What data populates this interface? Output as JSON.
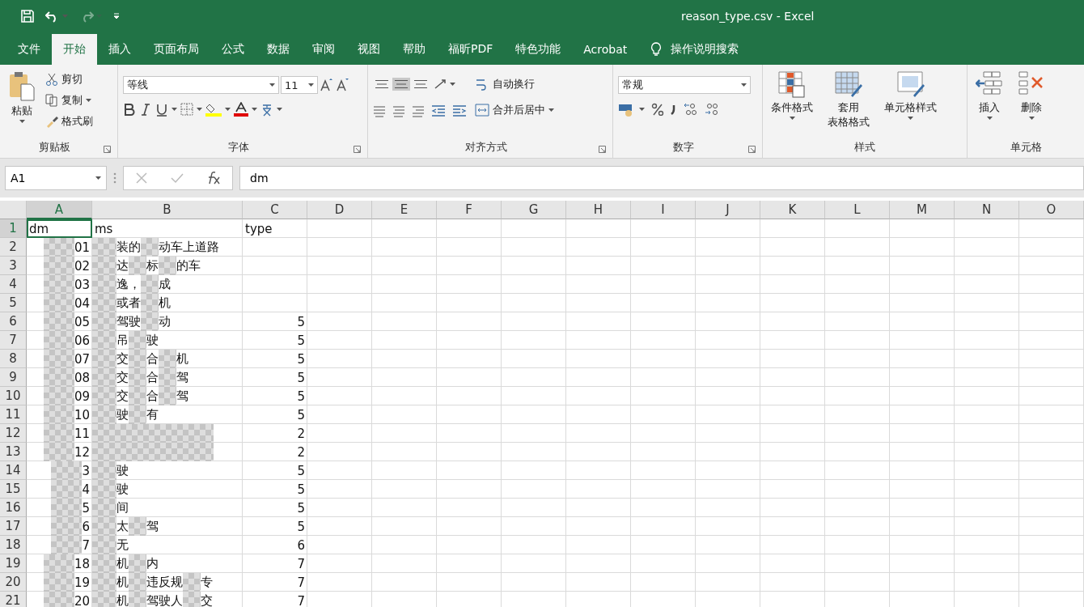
{
  "window": {
    "title": "reason_type.csv  -  Excel"
  },
  "tabs": [
    {
      "label": "文件",
      "selected": false
    },
    {
      "label": "开始",
      "selected": true
    },
    {
      "label": "插入",
      "selected": false
    },
    {
      "label": "页面布局",
      "selected": false
    },
    {
      "label": "公式",
      "selected": false
    },
    {
      "label": "数据",
      "selected": false
    },
    {
      "label": "审阅",
      "selected": false
    },
    {
      "label": "视图",
      "selected": false
    },
    {
      "label": "帮助",
      "selected": false
    },
    {
      "label": "福昕PDF",
      "selected": false
    },
    {
      "label": "特色功能",
      "selected": false
    },
    {
      "label": "Acrobat",
      "selected": false
    }
  ],
  "tell_me": {
    "placeholder": "操作说明搜索"
  },
  "ribbon": {
    "clipboard": {
      "label": "剪贴板",
      "paste": "粘贴",
      "cut": "剪切",
      "copy": "复制",
      "format_painter": "格式刷"
    },
    "font": {
      "label": "字体",
      "font_name": "等线",
      "font_size": "11"
    },
    "alignment": {
      "label": "对齐方式",
      "vertical_align": [
        {
          "selected": false
        },
        {
          "selected": true
        },
        {
          "selected": false
        }
      ],
      "wrap_text": "自动换行",
      "merge_center": "合并后居中"
    },
    "number": {
      "label": "数字",
      "format": "常规"
    },
    "styles": {
      "label": "样式",
      "conditional_format": "条件格式",
      "format_table": [
        "套用",
        "表格格式"
      ],
      "cell_styles": "单元格样式"
    },
    "cells": {
      "label": "单元格",
      "insert": "插入",
      "delete": "删除"
    }
  },
  "formula_bar": {
    "name_box": "A1",
    "formula": "dm"
  },
  "sheet": {
    "columns": [
      {
        "label": "A",
        "selected": true
      },
      {
        "label": "B",
        "selected": false
      },
      {
        "label": "C",
        "selected": false
      },
      {
        "label": "D",
        "selected": false
      },
      {
        "label": "E",
        "selected": false
      },
      {
        "label": "F",
        "selected": false
      },
      {
        "label": "G",
        "selected": false
      },
      {
        "label": "H",
        "selected": false
      },
      {
        "label": "I",
        "selected": false
      },
      {
        "label": "J",
        "selected": false
      },
      {
        "label": "K",
        "selected": false
      },
      {
        "label": "L",
        "selected": false
      },
      {
        "label": "M",
        "selected": false
      },
      {
        "label": "N",
        "selected": false
      },
      {
        "label": "O",
        "selected": false
      }
    ],
    "header_row": {
      "num": "1",
      "selected": true,
      "cells": [
        "dm",
        "ms",
        "type"
      ]
    },
    "rows": [
      {
        "num": "2",
        "dm": "01",
        "ms": [
          "装的",
          "动车上道路"
        ]
      },
      {
        "num": "3",
        "dm": "02",
        "ms": [
          "达",
          "标",
          "的车"
        ]
      },
      {
        "num": "4",
        "dm": "03",
        "ms": [
          "逸，",
          "成"
        ]
      },
      {
        "num": "5",
        "dm": "04",
        "ms": [
          "或者",
          "机"
        ]
      },
      {
        "num": "6",
        "dm": "05",
        "ms": [
          "驾驶",
          "动"
        ],
        "type": "5"
      },
      {
        "num": "7",
        "dm": "06",
        "ms": [
          "吊",
          "驶"
        ],
        "type": "5"
      },
      {
        "num": "8",
        "dm": "07",
        "ms": [
          "交",
          "合",
          "机"
        ],
        "type": "5"
      },
      {
        "num": "9",
        "dm": "08",
        "ms": [
          "交",
          "合",
          "驾"
        ],
        "type": "5"
      },
      {
        "num": "10",
        "dm": "09",
        "ms": [
          "交",
          "合",
          "驾"
        ],
        "type": "5"
      },
      {
        "num": "11",
        "dm": "10",
        "ms": [
          "驶",
          "有"
        ],
        "type": "5"
      },
      {
        "num": "12",
        "dm": "11",
        "ms": [],
        "type": "2"
      },
      {
        "num": "13",
        "dm": "12",
        "ms": [],
        "type": "2"
      },
      {
        "num": "14",
        "dm": "3",
        "ms": [
          "驶"
        ],
        "type": "5"
      },
      {
        "num": "15",
        "dm": "4",
        "ms": [
          "驶"
        ],
        "type": "5"
      },
      {
        "num": "16",
        "dm": "5",
        "ms": [
          "间"
        ],
        "type": "5"
      },
      {
        "num": "17",
        "dm": "6",
        "ms": [
          "太",
          "驾"
        ],
        "type": "5"
      },
      {
        "num": "18",
        "dm": "7",
        "ms": [
          "无"
        ],
        "type": "6"
      },
      {
        "num": "19",
        "dm": "18",
        "ms": [
          "机",
          "内"
        ],
        "type": "7"
      },
      {
        "num": "20",
        "dm": "19",
        "ms": [
          "机",
          "违反规",
          "专"
        ],
        "type": "7"
      },
      {
        "num": "21",
        "dm": "20",
        "ms": [
          "机",
          "驾驶人",
          "交"
        ],
        "type": "7"
      }
    ]
  }
}
